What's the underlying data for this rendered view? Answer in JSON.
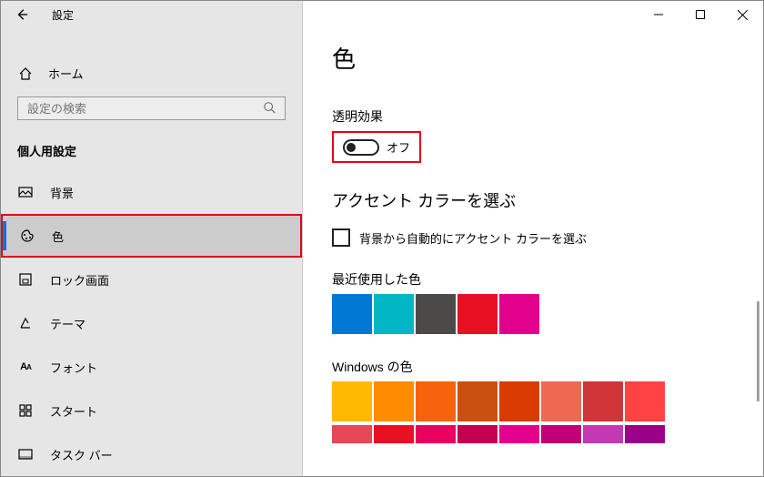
{
  "window": {
    "title": "設定"
  },
  "sidebar": {
    "home": "ホーム",
    "search_placeholder": "設定の検索",
    "section": "個人用設定",
    "items": [
      {
        "label": "背景"
      },
      {
        "label": "色"
      },
      {
        "label": "ロック画面"
      },
      {
        "label": "テーマ"
      },
      {
        "label": "フォント"
      },
      {
        "label": "スタート"
      },
      {
        "label": "タスク バー"
      }
    ]
  },
  "page": {
    "title": "色",
    "transparency": {
      "label": "透明効果",
      "state": "オフ"
    },
    "accent_heading": "アクセント カラーを選ぶ",
    "auto_accent_label": "背景から自動的にアクセント カラーを選ぶ",
    "recent_label": "最近使用した色",
    "recent_colors": [
      "#0078d4",
      "#00b7c3",
      "#4c4a48",
      "#e81123",
      "#e3008c"
    ],
    "windows_colors_label": "Windows の色",
    "windows_colors_row1": [
      "#ffb900",
      "#ff8c00",
      "#f7630c",
      "#ca5010",
      "#da3b01",
      "#ef6950",
      "#d13438",
      "#ff4343"
    ],
    "windows_colors_row2": [
      "#e74856",
      "#e81123",
      "#ea005e",
      "#c30052",
      "#e3008c",
      "#bf0077",
      "#c239b3",
      "#9a0089"
    ]
  }
}
